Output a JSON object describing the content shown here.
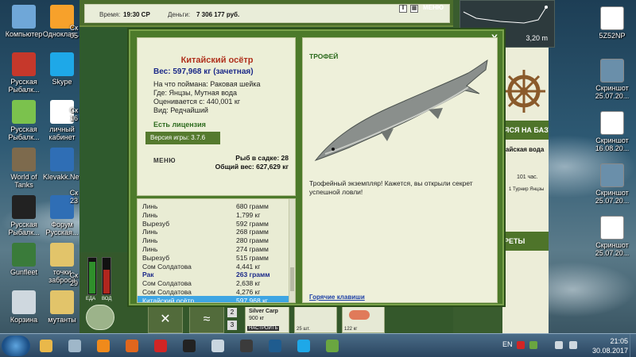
{
  "desktop": {
    "icons_left": [
      {
        "label": "Компьютер",
        "color": "#6fa7d8"
      },
      {
        "label": "Одноклас...",
        "color": "#f7a12b"
      },
      {
        "label": "Русская Рыбалк...",
        "color": "#c6382b"
      },
      {
        "label": "Skype",
        "color": "#1ea8e8"
      },
      {
        "label": "Русская Рыбалк...",
        "color": "#7bc24d"
      },
      {
        "label": "личный кабинет",
        "color": "#ffffff"
      },
      {
        "label": "World of Tanks",
        "color": "#7d6a4d"
      },
      {
        "label": "Klevakk.Net",
        "color": "#2f6eb5"
      },
      {
        "label": "Русская Рыбалк...",
        "color": "#222222"
      },
      {
        "label": "Форум Русская...",
        "color": "#2f6eb5"
      },
      {
        "label": "Gunfleet",
        "color": "#3a7b3a"
      },
      {
        "label": "точки заброса",
        "color": "#e2c46a"
      },
      {
        "label": "Корзина",
        "color": "#cfd8df"
      },
      {
        "label": "мутанты",
        "color": "#e2c46a"
      }
    ],
    "icons_left_partial": [
      "Ск 05",
      "Ск 16",
      "Ск 23",
      "Ск 29"
    ],
    "icons_right": [
      {
        "label": "5Z52NP",
        "color": "#ffffff"
      },
      {
        "label": "Скриншот 25.07.20...",
        "color": "#6a8faa"
      },
      {
        "label": "Скриншот 16.08.20...",
        "color": "#ffffff"
      },
      {
        "label": "Скриншот 25.07.20...",
        "color": "#6a8faa"
      },
      {
        "label": "Скриншот 25.07.20...",
        "color": "#ffffff"
      }
    ]
  },
  "game": {
    "time_label": "Время:",
    "time_value": "19:30 СР",
    "money_label": "Деньги:",
    "money_value": "7 306 177 руб.",
    "menu_button": "МЕНЮ",
    "depth": "3,20 m",
    "right_panel": {
      "header1": "ЯСЯ НА БАЗУ",
      "sub1": "айская вода",
      "line1": "101 час.",
      "line2": "1 Турнир Янцзы",
      "header2": "РЕТЫ"
    },
    "meter_labels": [
      "ЕДА",
      "ВОД"
    ],
    "slot_numbers": [
      "2",
      "3"
    ],
    "item": {
      "name": "Silver Carp",
      "weight": "900 кг",
      "button": "НАСТРОИТЬ",
      "price1": "25 шт.",
      "price2": "122 кг"
    }
  },
  "dialog": {
    "close": "X",
    "fish_title": "Китайский осётр",
    "weight": "Вес: 597,968 кг (зачетная)",
    "bait": "На что поймана: Раковая шейка",
    "location": "Где: Янцзы, Мутная вода",
    "estimated": "Оценивается с: 440,001 кг",
    "species": "Вид: Редчайший",
    "license": "Есть лицензия",
    "version": "Версия игры: 3.7.6",
    "menu": "МЕНЮ",
    "keepnet_count": "Рыб в садке: 28",
    "keepnet_weight": "Общий вес: 627,629 кг",
    "catch_list": [
      {
        "name": "Линь",
        "weight": "680 грамм",
        "style": ""
      },
      {
        "name": "Линь",
        "weight": "1,799 кг",
        "style": ""
      },
      {
        "name": "Вырезуб",
        "weight": "592 грамм",
        "style": ""
      },
      {
        "name": "Линь",
        "weight": "268 грамм",
        "style": ""
      },
      {
        "name": "Линь",
        "weight": "280 грамм",
        "style": ""
      },
      {
        "name": "Линь",
        "weight": "274 грамм",
        "style": ""
      },
      {
        "name": "Вырезуб",
        "weight": "515 грамм",
        "style": ""
      },
      {
        "name": "Сом Солдатова",
        "weight": "4,441 кг",
        "style": ""
      },
      {
        "name": "Рак",
        "weight": "263 грамм",
        "style": "bold"
      },
      {
        "name": "Сом Солдатова",
        "weight": "2,638 кг",
        "style": ""
      },
      {
        "name": "Сом Солдатова",
        "weight": "4,276 кг",
        "style": ""
      },
      {
        "name": "Китайский осётр",
        "weight": "597,968 кг",
        "style": "sel"
      }
    ],
    "trophy_label": "ТРОФЕЙ",
    "trophy_text": "Трофейный экземпляр! Кажется, вы открыли секрет успешной ловли!",
    "hotkeys": "Горячие клавиши"
  },
  "taskbar": {
    "apps": [
      {
        "name": "explorer",
        "color": "#e9b84a"
      },
      {
        "name": "calculator",
        "color": "#9fb7c9"
      },
      {
        "name": "avast",
        "color": "#f08a1b"
      },
      {
        "name": "firefox",
        "color": "#e0661d"
      },
      {
        "name": "opera",
        "color": "#d22525"
      },
      {
        "name": "rr3",
        "color": "#222222"
      },
      {
        "name": "paint",
        "color": "#c9d6e0"
      },
      {
        "name": "clock",
        "color": "#3b3b3b"
      },
      {
        "name": "window",
        "color": "#1f5c8f"
      },
      {
        "name": "skype",
        "color": "#1ea8e8"
      },
      {
        "name": "game",
        "color": "#6aa640"
      }
    ],
    "lang": "EN",
    "time": "21:05",
    "date": "30.08.2017"
  }
}
